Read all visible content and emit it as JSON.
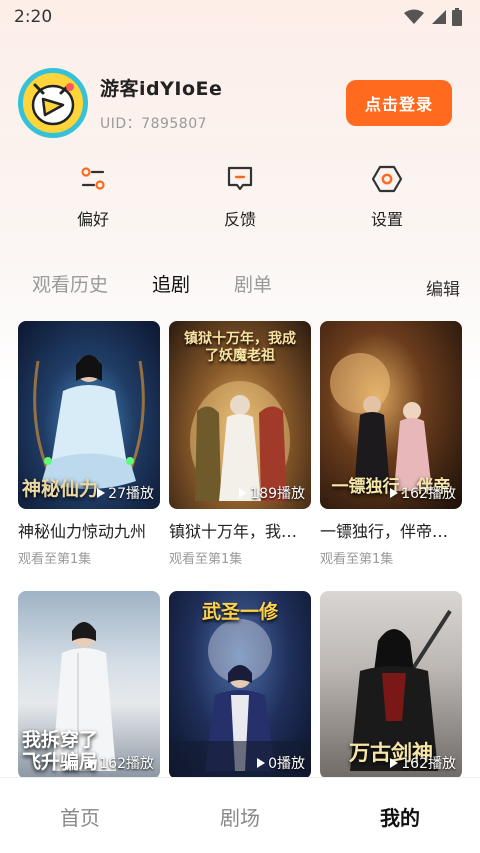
{
  "status_bar": {
    "time": "2:20"
  },
  "profile": {
    "username": "游客idYIoEe",
    "uid": "UID：7895807",
    "login_label": "点击登录"
  },
  "quick_actions": [
    {
      "label": "偏好",
      "icon": "sliders-icon"
    },
    {
      "label": "反馈",
      "icon": "feedback-icon"
    },
    {
      "label": "设置",
      "icon": "settings-icon"
    }
  ],
  "tabs": [
    {
      "label": "观看历史",
      "active": false
    },
    {
      "label": "追剧",
      "active": true
    },
    {
      "label": "剧单",
      "active": false
    }
  ],
  "edit_label": "编辑",
  "dramas": [
    {
      "poster_text": "神秘仙力",
      "plays": "27播放",
      "title": "神秘仙力惊动九州",
      "progress": "观看至第1集"
    },
    {
      "poster_text": "镇狱十万年，我成了妖魔老祖",
      "plays": "189播放",
      "title": "镇狱十万年，我成了妖魔老祖",
      "progress": "观看至第1集"
    },
    {
      "poster_text": "一镖独行，伴帝",
      "plays": "162播放",
      "title": "一镖独行，伴帝…",
      "progress": "观看至第1集"
    },
    {
      "poster_text": "我拆穿了飞升骗局",
      "plays": "162播放",
      "title": "",
      "progress": ""
    },
    {
      "poster_text": "武圣一修",
      "plays": "0播放",
      "title": "",
      "progress": ""
    },
    {
      "poster_text": "万古剑神",
      "plays": "162播放",
      "title": "",
      "progress": ""
    }
  ],
  "bottom_nav": [
    {
      "label": "首页",
      "active": false
    },
    {
      "label": "剧场",
      "active": false
    },
    {
      "label": "我的",
      "active": true
    }
  ],
  "colors": {
    "accent": "#ff6a1e",
    "avatar_ring": "#35c2d9",
    "avatar_fill": "#ffd53a"
  }
}
